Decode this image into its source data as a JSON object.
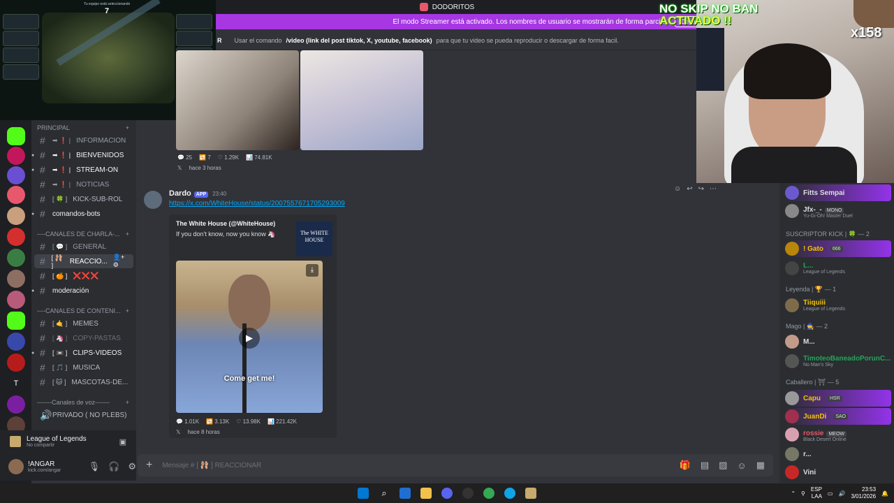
{
  "window": {
    "title": "DODORITOS"
  },
  "banner": {
    "text": "El modo Streamer está activado. Los nombres de usuario se mostrarán de forma parcial.",
    "button": "Desactivar"
  },
  "topic": {
    "prefix": "R",
    "text_pre": "Usar el comando",
    "command": "/video (link del post tiktok, X, youtube, facebook)",
    "text_post": "para que tu video se pueda reproducir o descargar de forma facil."
  },
  "game": {
    "caption": "Tu equipo está seleccionando",
    "number": "7"
  },
  "sidebar": {
    "category_principal": "PRINCIPAL",
    "channels_top": [
      {
        "name": "INFORMACION",
        "prefix": "➡ ❗ |"
      },
      {
        "name": "BIENVENIDOS",
        "prefix": "➡ ❗ |"
      },
      {
        "name": "STREAM-ON",
        "prefix": "➡ ❗ |"
      },
      {
        "name": "NOTICIAS",
        "prefix": "➡ ❗ |"
      },
      {
        "name": "KICK-SUB-ROL",
        "prefix": "[ 🍀 ]"
      },
      {
        "name": "comandos-bots",
        "prefix": ""
      }
    ],
    "category_charla": "----CANALES DE CHARLA-...",
    "channels_charla": [
      {
        "name": "GENERAL",
        "prefix": "[ 💬 ]"
      },
      {
        "name": "REACCIO...",
        "prefix": "[ 🩰 ]"
      },
      {
        "name": "❌❌❌",
        "prefix": "[ 🍊 ]"
      },
      {
        "name": "moderación",
        "prefix": ""
      }
    ],
    "category_contenido": "----CANALES DE CONTENI...",
    "channels_contenido": [
      {
        "name": "MEMES",
        "prefix": "[ 🤙 ]"
      },
      {
        "name": "COPY-PASTAS",
        "prefix": "[ 🦄 ]"
      },
      {
        "name": "CLIPS-VIDEOS",
        "prefix": "[ 📼 ]"
      },
      {
        "name": "MUSICA",
        "prefix": "[ 🎵 ]"
      },
      {
        "name": "MASCOTAS-DE...",
        "prefix": "[ 🐱 ]"
      }
    ],
    "category_voz": "-------Canales de voz-------",
    "voice": {
      "name": "PRIVADO ( NO PLEBS)"
    }
  },
  "activity": {
    "game": "League of Legends",
    "status": "No compartir"
  },
  "user": {
    "name": "!ANGAR",
    "sub": "kick.com/angar"
  },
  "messages": {
    "first_stats": {
      "replies": "25",
      "reposts": "7",
      "likes": "1.29K",
      "views": "74.81K",
      "time": "hace 3 horas"
    },
    "author": "Dardo",
    "badge": "APP",
    "timestamp": "23:40",
    "link": "https://x.com/WhiteHouse/status/2007557671705293009",
    "embed_author": "The White House (@WhiteHouse)",
    "embed_text": "If you don't know, now you know 🦄",
    "embed_logo": "The WHITE HOUSE",
    "video_caption": "Come get me!",
    "stats": {
      "replies": "1.01K",
      "reposts": "3.13K",
      "likes": "13.98K",
      "views": "221.42K",
      "time": "hace 8 horas"
    }
  },
  "composer": {
    "placeholder": "Mensaje #  [ 🩰 ]  REACCIONAR"
  },
  "members": {
    "top": [
      {
        "name": "Fitts Sempai",
        "status": "",
        "color": "#dbdee1"
      },
      {
        "name": "Jfx-_-",
        "status": "Yu-Gi-Oh! Master Duel",
        "tag": "MONO",
        "color": "#dbdee1"
      }
    ],
    "group_kick": "SUSCRIPTOR KICK | 🍀 — 2",
    "kick": [
      {
        "name": "! Gato",
        "tag": "666",
        "status": "",
        "color": "#f5c400"
      },
      {
        "name": "L...",
        "status": "League of Legends",
        "color": "#23a55a"
      }
    ],
    "group_leyenda": "Leyenda | 🏆 — 1",
    "leyenda": [
      {
        "name": "Tiiquiii",
        "status": "League of Legends",
        "color": "#f5c400"
      }
    ],
    "group_mago": "Mago | 🧙 — 2",
    "mago": [
      {
        "name": "M...",
        "status": "",
        "color": "#dbdee1"
      },
      {
        "name": "TimoteoBaneadoPorunC...",
        "status": "No Man's Sky",
        "color": "#23a55a"
      }
    ],
    "group_caballero": "Caballero | ⛩ — 5",
    "caballero": [
      {
        "name": "Capu",
        "tag": "HSR",
        "status": "",
        "color": "#f5c400"
      },
      {
        "name": "JuanDi",
        "tag": "SAO",
        "status": "",
        "color": "#f5c400"
      },
      {
        "name": "rossie",
        "tag": "MEOW",
        "status": "Black Desert Online",
        "color": "#e8586d"
      },
      {
        "name": "r...",
        "tag": "",
        "status": "",
        "color": "#dbdee1"
      },
      {
        "name": "Vini",
        "status": "",
        "color": "#dbdee1"
      }
    ]
  },
  "overlay": {
    "line1": "NO SKIP NO BAN",
    "line2": "ACTIVADO !!",
    "count": "x158"
  },
  "tray": {
    "lang1": "ESP",
    "lang2": "LAA",
    "time": "23:53",
    "date": "3/01/2026"
  }
}
